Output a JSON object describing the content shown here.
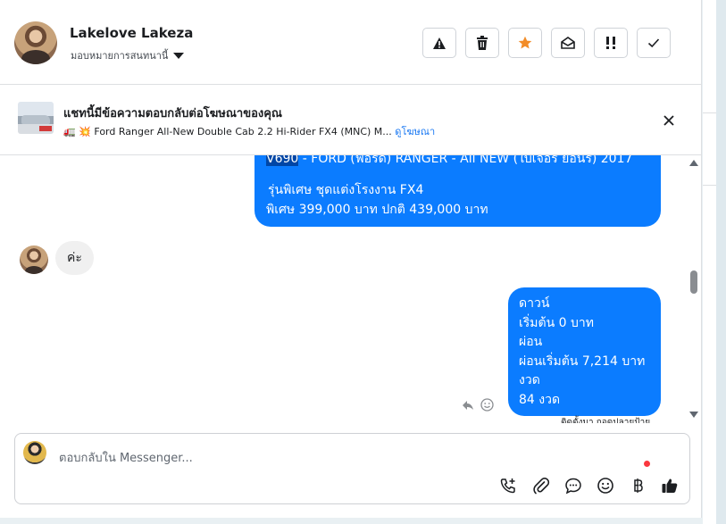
{
  "contact": {
    "name": "Lakelove Lakeza",
    "assign_label": "มอบหมายการสนทนานี้"
  },
  "toolbar": {
    "icons": [
      "warning-icon",
      "trash-icon",
      "star-icon",
      "mark-unread-icon",
      "important-icon",
      "check-icon"
    ],
    "star_color": "#f28c28"
  },
  "ad_banner": {
    "title": "แชทนี้มีข้อความตอบกลับต่อโฆษณาของคุณ",
    "ad_prefix": "🚛 💥",
    "ad_text": "Ford Ranger All-New Double Cab 2.2 Hi-Rider FX4 (MNC) M...",
    "link": "ดูโฆษณา"
  },
  "messages": {
    "first_outgoing": {
      "line1_code": "V690",
      "line1_rest": " - FORD (ฟอร์ด) RANGER - All NEW (ใบเจอร์ ยอนร) 2017",
      "line2": "รุ่นพิเศษ ชุดแต่งโรงงาน FX4",
      "line3": "พิเศษ 399,000 บาท  ปกติ 439,000 บาท"
    },
    "incoming": {
      "text": "ค่ะ"
    },
    "second_outgoing": {
      "lines": [
        "ดาวน์",
        "เริ่มต้น 0 บาท",
        "ผ่อน",
        "ผ่อนเริ่มต้น 7,214 บาท",
        "งวด",
        "84 งวด"
      ]
    },
    "cut_off_text": "ติดตั้งมา ถอดปลายป้าย"
  },
  "composer": {
    "placeholder": "ตอบกลับใน Messenger...",
    "icons": [
      "call-add-icon",
      "paperclip-icon",
      "chat-bubble-icon",
      "emoji-icon",
      "baht-icon",
      "thumbs-up-icon"
    ]
  },
  "colors": {
    "outgoing_bubble": "#0b7cff",
    "incoming_bubble": "#f0f0f0",
    "link": "#1877f2"
  }
}
